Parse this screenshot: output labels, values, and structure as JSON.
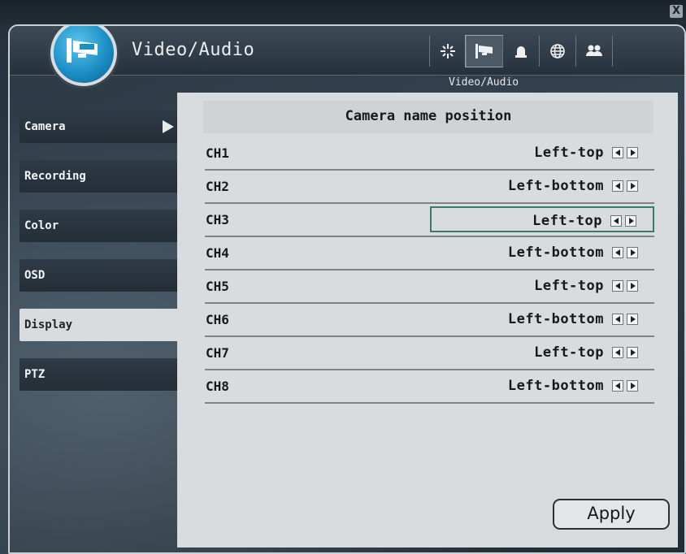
{
  "window": {
    "title": "Video/Audio",
    "close_label": "X"
  },
  "toolbar": {
    "icons": [
      "system-icon",
      "camera-icon",
      "alarm-icon",
      "network-icon",
      "user-icon"
    ],
    "active_index": 1
  },
  "breadcrumb": "Video/Audio",
  "sidebar": {
    "items": [
      {
        "label": "Camera",
        "has_arrow": true
      },
      {
        "label": "Recording"
      },
      {
        "label": "Color"
      },
      {
        "label": "OSD"
      },
      {
        "label": "Display",
        "active": true
      },
      {
        "label": "PTZ"
      }
    ]
  },
  "panel": {
    "header": "Camera name position",
    "rows": [
      {
        "channel": "CH1",
        "value": "Left-top"
      },
      {
        "channel": "CH2",
        "value": "Left-bottom"
      },
      {
        "channel": "CH3",
        "value": "Left-top",
        "selected": true
      },
      {
        "channel": "CH4",
        "value": "Left-bottom"
      },
      {
        "channel": "CH5",
        "value": "Left-top"
      },
      {
        "channel": "CH6",
        "value": "Left-bottom"
      },
      {
        "channel": "CH7",
        "value": "Left-top"
      },
      {
        "channel": "CH8",
        "value": "Left-bottom"
      }
    ],
    "apply_label": "Apply"
  },
  "colors": {
    "accent": "#1d8fc6",
    "panel_bg": "#d8dcdf",
    "selection": "#3a7a6a"
  }
}
